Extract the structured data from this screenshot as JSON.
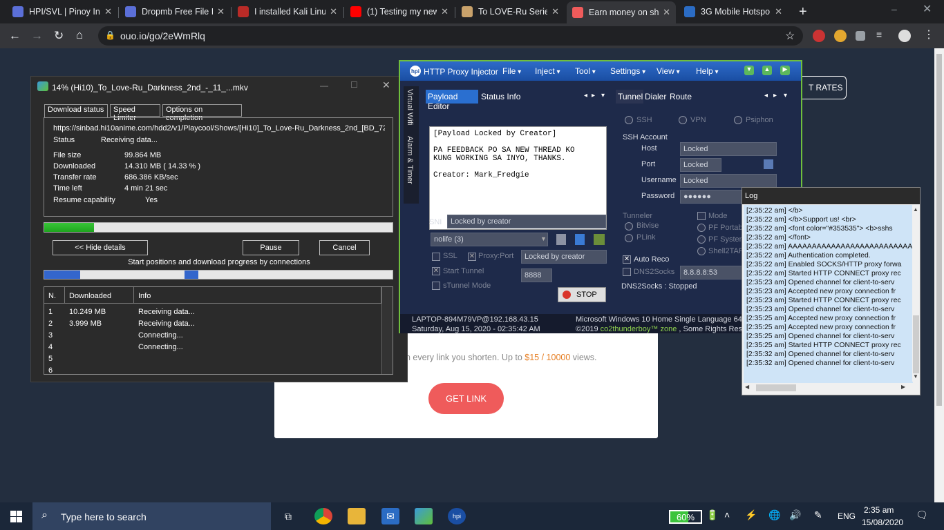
{
  "browser": {
    "tabs": [
      {
        "title": "HPI/SVL | Pinoy In",
        "icon": "cube-icon"
      },
      {
        "title": "Dropmb Free File I",
        "icon": "cube-icon"
      },
      {
        "title": "I installed Kali Linu",
        "icon": "q-icon"
      },
      {
        "title": "(1) Testing my new",
        "icon": "youtube-icon"
      },
      {
        "title": "To LOVE-Ru Series",
        "icon": "anime-icon"
      },
      {
        "title": "Earn money on sh",
        "icon": "ouo-icon"
      },
      {
        "title": "3G Mobile Hotspo",
        "icon": "globe-icon"
      }
    ],
    "active_tab": 5,
    "url": "ouo.io/go/2eWmRlq"
  },
  "page": {
    "rates_label": "T RATES",
    "earn_text_pre": "on every link you shorten. Up to ",
    "earn_text_hl": "$15 / 10000",
    "earn_text_post": " views.",
    "get_link": "GET LINK",
    "accent": "#ef5b5b"
  },
  "idm": {
    "title": "14% (Hi10)_To_Love-Ru_Darkness_2nd_-_11_...mkv",
    "tabs": [
      "Download status",
      "Speed Limiter",
      "Options on completion"
    ],
    "url": "https://sinbad.hi10anime.com/hdd2/v1/Playcool/Shows/[Hi10]_To_Love-Ru_Darkness_2nd_[BD_72",
    "status_label": "Status",
    "status_value": "Receiving data...",
    "file_size_label": "File size",
    "file_size": "99.864  MB",
    "downloaded_label": "Downloaded",
    "downloaded": "14.310  MB  ( 14.33 % )",
    "rate_label": "Transfer rate",
    "rate": "686.386  KB/sec",
    "time_left_label": "Time left",
    "time_left": "4 min 21 sec",
    "resume_label": "Resume capability",
    "resume": "Yes",
    "progress": 0.1433,
    "hide_details": "<< Hide details",
    "pause": "Pause",
    "cancel": "Cancel",
    "connections_label": "Start positions and download progress by connections",
    "columns": [
      "N.",
      "Downloaded",
      "Info"
    ],
    "rows": [
      {
        "n": "1",
        "downloaded": "10.249  MB",
        "info": "Receiving data..."
      },
      {
        "n": "2",
        "downloaded": "3.999  MB",
        "info": "Receiving data..."
      },
      {
        "n": "3",
        "downloaded": "",
        "info": "Connecting..."
      },
      {
        "n": "4",
        "downloaded": "",
        "info": "Connecting..."
      },
      {
        "n": "5",
        "downloaded": "",
        "info": ""
      },
      {
        "n": "6",
        "downloaded": "",
        "info": ""
      }
    ]
  },
  "hpi": {
    "title": "HTTP Proxy Injector",
    "menus": [
      "File",
      "Inject",
      "Tool",
      "Settings",
      "View",
      "Help"
    ],
    "vtabs": [
      "Virtual Wifi",
      "Alarm & Timer"
    ],
    "left_tabs": [
      "Payload Editor",
      "Status Info"
    ],
    "payload": "[Payload Locked by Creator]\n\nPA FEEDBACK PO SA NEW THREAD KO\nKUNG WORKING SA INYO, THANKS.\n\nCreator: Mark_Fredgie",
    "sni_label": "SNI",
    "sni_value": "Locked by creator",
    "profile": "nolife (3)",
    "ssl": "SSL",
    "proxy_port": "Proxy:Port",
    "proxy_value": "Locked by creator",
    "start_tunnel": "Start Tunnel",
    "port_value": "8888",
    "stunnel": "sTunnel Mode",
    "stop": "STOP",
    "right_tabs": [
      "Tunnel",
      "Dialer",
      "Route"
    ],
    "modes": [
      "SSH",
      "VPN",
      "Psiphon"
    ],
    "ssh_account": "SSH Account",
    "host_label": "Host",
    "host_value": "Locked",
    "port_label": "Port",
    "sport_value": "Locked",
    "user_label": "Username",
    "user_value": "Locked",
    "pass_label": "Password",
    "pass_value": "●●●●●●",
    "tunneler": "Tunneler",
    "tun_opts": [
      "Bitvise",
      "PLink"
    ],
    "mode_label": "Mode",
    "mode_opts": [
      "PF Portab",
      "PF System",
      "Shell2TAP"
    ],
    "auto_reco": "Auto Reco",
    "dns2socks": "DNS2Socks",
    "dns_value": "8.8.8.8:53",
    "dns_status": "DNS2Socks : Stopped",
    "host_machine": "LAPTOP-894M79VP@192.168.43.15",
    "datetime": "Saturday, Aug 15, 2020 - 02:35:42 AM",
    "os": "Microsoft Windows 10 Home Single Language 64-b",
    "copyright_pre": "©2019 ",
    "copyright_hl": "co2thunderboy™ zone",
    "copyright_post": " , Some Rights Rese"
  },
  "log": {
    "title": "Log",
    "lines": [
      "[2:35:22 am]  </b>",
      "[2:35:22 am]  </b>Support us! <br>",
      "[2:35:22 am]  <font color=\"#353535\"> <b>sshs",
      "[2:35:22 am]  </font>",
      "[2:35:22 am]  AAAAAAAAAAAAAAAAAAAAAAAAAAA",
      "[2:35:22 am]  Authentication completed.",
      "[2:35:22 am]  Enabled SOCKS/HTTP proxy forwa",
      "[2:35:22 am]  Started HTTP CONNECT proxy rec",
      "[2:35:23 am]  Opened channel for client-to-serv",
      "[2:35:23 am]  Accepted new proxy connection fr",
      "[2:35:23 am]  Started HTTP CONNECT proxy rec",
      "[2:35:23 am]  Opened channel for client-to-serv",
      "[2:35:25 am]  Accepted new proxy connection fr",
      "[2:35:25 am]  Accepted new proxy connection fr",
      "[2:35:25 am]  Opened channel for client-to-serv",
      "[2:35:25 am]  Started HTTP CONNECT proxy rec",
      "[2:35:32 am]  Opened channel for client-to-serv",
      "[2:35:32 am]  Opened channel for client-to-serv"
    ]
  },
  "taskbar": {
    "search_placeholder": "Type here to search",
    "battery": "60%",
    "battery_level": 0.6,
    "lang": "ENG",
    "time": "2:35 am",
    "date": "15/08/2020"
  }
}
